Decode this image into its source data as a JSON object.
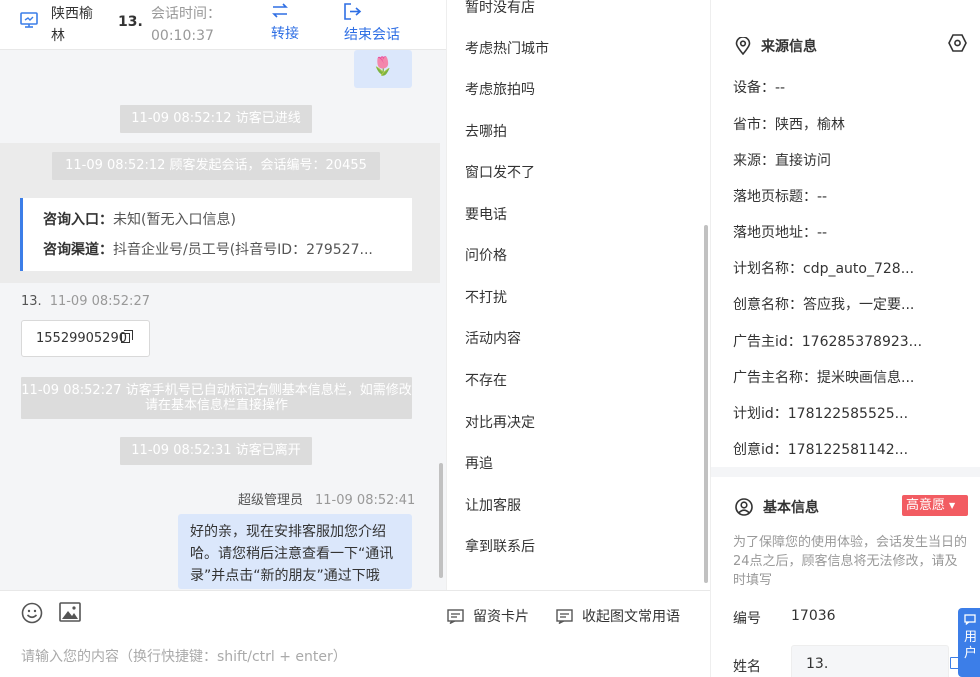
{
  "header": {
    "location": "陕西榆林",
    "visitor_name": "13.",
    "session_time_label": "会话时间：",
    "session_time": "00:10:37",
    "transfer_label": "转接",
    "end_label": "结束会话"
  },
  "chat": {
    "flower_emoji": "🌷",
    "sys_enter": "11-09 08:52:12 访客已进线",
    "sys_start": "11-09 08:52:12 顾客发起会话，会话编号：20455",
    "entry_key": "咨询入口：",
    "entry_val": "未知(暂无入口信息)",
    "channel_key": "咨询渠道：",
    "channel_val": "抖音企业号/员工号(抖音号ID：279527...",
    "visitor_name": "13.",
    "visitor_time": "11-09 08:52:27",
    "phone": "15529905290",
    "sys_auto_tag": "11-09 08:52:27 访客手机号已自动标记右侧基本信息栏，如需修改请在基本信息栏直接操作",
    "sys_leave": "11-09 08:52:31 访客已离开",
    "agent_name": "超级管理员",
    "agent_time": "11-09 08:52:41",
    "agent_msg": "好的亲，现在安排客服加您介绍哈。请您稍后注意查看一下“通讯录”并点击“新的朋友”通过下哦"
  },
  "input": {
    "tool_card": "留资卡片",
    "tool_collapse": "收起图文常用语",
    "placeholder": "请输入您的内容（换行快捷键：shift/ctrl + enter）"
  },
  "quick_replies": [
    "暂时没有店",
    "考虑热门城市",
    "考虑旅拍吗",
    "去哪拍",
    "窗口发不了",
    "要电话",
    "问价格",
    "不打扰",
    "活动内容",
    "不存在",
    "对比再决定",
    "再追",
    "让加客服",
    "拿到联系后"
  ],
  "source": {
    "title": "来源信息",
    "rows": [
      "设备：--",
      "省市：陕西，榆林",
      "来源：直接访问",
      "落地页标题：--",
      "落地页地址：--",
      "计划名称：cdp_auto_728...",
      "创意名称：答应我，一定要...",
      "广告主id：176285378923...",
      "广告主名称：提米映画信息...",
      "计划id：178122585525...",
      "创意id：178122581142..."
    ]
  },
  "basic": {
    "title": "基本信息",
    "intent": "高意愿",
    "note": "为了保障您的使用体验，会话发生当日的24点之后，顾客信息将无法修改，请及时填写",
    "id_label": "编号",
    "id_value": "17036",
    "name_label": "姓名",
    "name_value": "13."
  },
  "float_tab": "用户"
}
